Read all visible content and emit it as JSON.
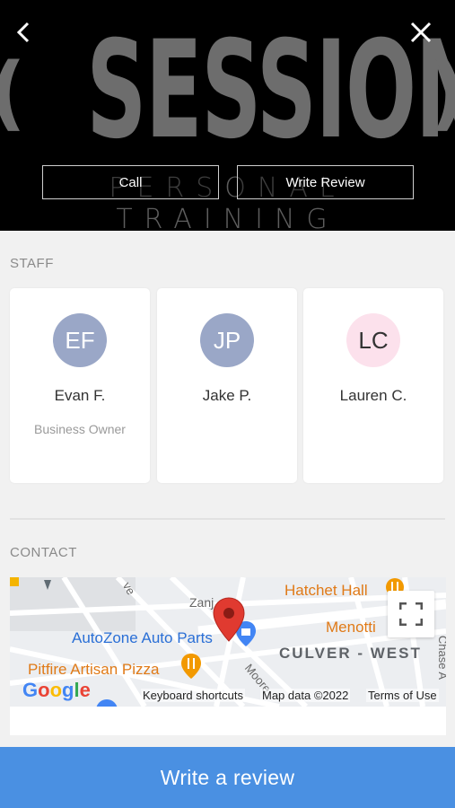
{
  "header": {
    "logo_word": "SESSIONS",
    "logo_left_paren": "(",
    "logo_right_paren": ")",
    "logo_subtitle": "PERSONAL TRAINING",
    "call_label": "Call",
    "write_review_label": "Write Review",
    "back_icon": "chevron-left-icon",
    "close_icon": "close-icon"
  },
  "staff": {
    "title": "STAFF",
    "members": [
      {
        "initials": "EF",
        "name": "Evan F.",
        "role": "Business Owner",
        "avatar_color": "#9aa7c7",
        "initials_color": "#ffffff"
      },
      {
        "initials": "JP",
        "name": "Jake P.",
        "role": "",
        "avatar_color": "#9aa7c7",
        "initials_color": "#ffffff"
      },
      {
        "initials": "LC",
        "name": "Lauren C.",
        "role": "",
        "avatar_color": "#fce1ec",
        "initials_color": "#333333"
      }
    ]
  },
  "contact": {
    "title": "CONTACT",
    "map": {
      "labels": {
        "hatchet": "Hatchet Hall",
        "menotti": "Menotti",
        "autozone": "AutoZone Auto Parts",
        "pitfire": "Pitfire Artisan Pizza",
        "culver": "CULVER - WEST",
        "zanja": "Zanj",
        "moore": "Moore",
        "chase": "Chase A",
        "ve": "ve"
      },
      "google": [
        "G",
        "o",
        "o",
        "g",
        "l",
        "e"
      ],
      "keyboard_shortcuts": "Keyboard shortcuts",
      "map_data": "Map data ©2022",
      "terms": "Terms of Use",
      "fullscreen_icon": "fullscreen-icon",
      "pin_icon": "map-pin-icon"
    }
  },
  "footer": {
    "write_review_label": "Write a review"
  },
  "colors": {
    "accent": "#4a90e2",
    "poi_orange": "#e07a17",
    "poi_blue": "#2a6fd6",
    "pin_red": "#e03a30"
  }
}
